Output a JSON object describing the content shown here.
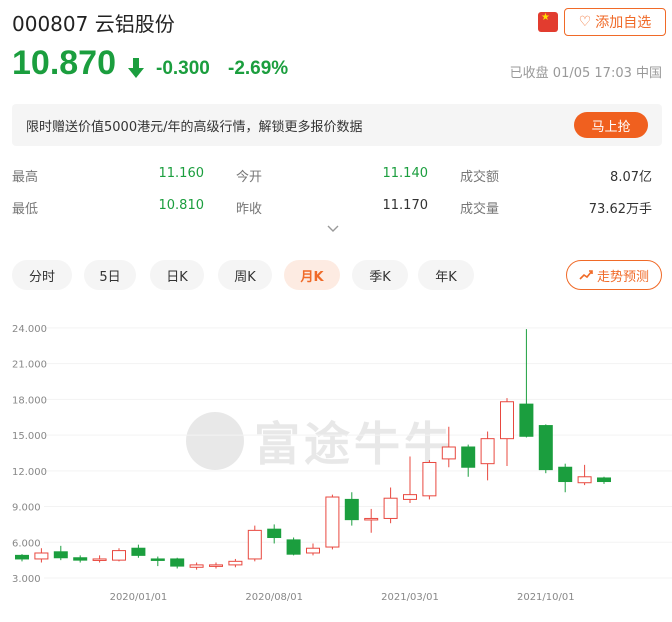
{
  "header": {
    "stock_code": "000807",
    "stock_name": "云铝股份",
    "watch_label": "添加自选",
    "flag_icon": "china-flag-icon",
    "heart_icon": "heart-icon"
  },
  "quote": {
    "price": "10.870",
    "change": "-0.300",
    "change_pct": "-2.69%",
    "status": "已收盘 01/05 17:03 中国",
    "down_color": "#1b9e3e"
  },
  "promo": {
    "text": "限时赠送价值5000港元/年的高级行情，解锁更多报价数据",
    "button": "马上抢"
  },
  "stats": {
    "high_label": "最高",
    "high": "11.160",
    "low_label": "最低",
    "low": "10.810",
    "open_label": "今开",
    "open": "11.140",
    "prev_label": "昨收",
    "prev": "11.170",
    "amount_label": "成交额",
    "amount": "8.07亿",
    "volume_label": "成交量",
    "volume": "73.62万手"
  },
  "periods": {
    "items": [
      "分时",
      "5日",
      "日K",
      "周K",
      "月K",
      "季K",
      "年K"
    ],
    "active": "月K",
    "trend_label": "走势预测"
  },
  "watermark": "富途牛牛",
  "chart_data": {
    "type": "candlestick",
    "up_color": "#e8483f",
    "down_color": "#1b9e3e",
    "ylim": [
      3.0,
      25.0
    ],
    "y_ticks": [
      "24.000",
      "21.000",
      "18.000",
      "15.000",
      "12.000",
      "9.000",
      "6.000",
      "3.000"
    ],
    "x_ticks": [
      "2020/01/01",
      "2020/08/01",
      "2021/03/01",
      "2021/10/01"
    ],
    "candles": [
      {
        "o": 4.9,
        "c": 4.6,
        "h": 5.0,
        "l": 4.4
      },
      {
        "o": 4.6,
        "c": 5.1,
        "h": 5.5,
        "l": 4.3
      },
      {
        "o": 5.2,
        "c": 4.7,
        "h": 5.7,
        "l": 4.5
      },
      {
        "o": 4.7,
        "c": 4.5,
        "h": 4.9,
        "l": 4.3
      },
      {
        "o": 4.5,
        "c": 4.6,
        "h": 4.9,
        "l": 4.3
      },
      {
        "o": 4.5,
        "c": 5.3,
        "h": 5.5,
        "l": 4.4
      },
      {
        "o": 5.5,
        "c": 4.9,
        "h": 5.8,
        "l": 4.7
      },
      {
        "o": 4.6,
        "c": 4.5,
        "h": 4.8,
        "l": 4.0
      },
      {
        "o": 4.6,
        "c": 4.0,
        "h": 4.7,
        "l": 3.8
      },
      {
        "o": 3.9,
        "c": 4.1,
        "h": 4.3,
        "l": 3.7
      },
      {
        "o": 4.0,
        "c": 4.1,
        "h": 4.3,
        "l": 3.8
      },
      {
        "o": 4.1,
        "c": 4.4,
        "h": 4.6,
        "l": 3.9
      },
      {
        "o": 4.6,
        "c": 7.0,
        "h": 7.4,
        "l": 4.4
      },
      {
        "o": 7.1,
        "c": 6.4,
        "h": 7.5,
        "l": 5.9
      },
      {
        "o": 6.2,
        "c": 5.0,
        "h": 6.4,
        "l": 4.9
      },
      {
        "o": 5.1,
        "c": 5.5,
        "h": 5.9,
        "l": 4.9
      },
      {
        "o": 5.6,
        "c": 9.8,
        "h": 10.0,
        "l": 5.4
      },
      {
        "o": 9.6,
        "c": 7.9,
        "h": 10.2,
        "l": 7.4
      },
      {
        "o": 7.9,
        "c": 8.0,
        "h": 8.8,
        "l": 6.8
      },
      {
        "o": 8.0,
        "c": 9.7,
        "h": 10.6,
        "l": 7.6
      },
      {
        "o": 9.6,
        "c": 10.0,
        "h": 13.2,
        "l": 9.3
      },
      {
        "o": 9.9,
        "c": 12.7,
        "h": 12.9,
        "l": 9.6
      },
      {
        "o": 13.0,
        "c": 14.0,
        "h": 15.7,
        "l": 12.3
      },
      {
        "o": 14.0,
        "c": 12.3,
        "h": 14.2,
        "l": 11.5
      },
      {
        "o": 12.6,
        "c": 14.7,
        "h": 15.3,
        "l": 11.2
      },
      {
        "o": 14.7,
        "c": 17.8,
        "h": 18.1,
        "l": 12.4
      },
      {
        "o": 17.6,
        "c": 14.9,
        "h": 23.9,
        "l": 14.8
      },
      {
        "o": 15.8,
        "c": 12.1,
        "h": 15.9,
        "l": 11.8
      },
      {
        "o": 12.3,
        "c": 11.1,
        "h": 12.6,
        "l": 10.2
      },
      {
        "o": 11.0,
        "c": 11.5,
        "h": 12.5,
        "l": 10.8
      },
      {
        "o": 11.4,
        "c": 11.1,
        "h": 11.5,
        "l": 10.9
      }
    ]
  }
}
